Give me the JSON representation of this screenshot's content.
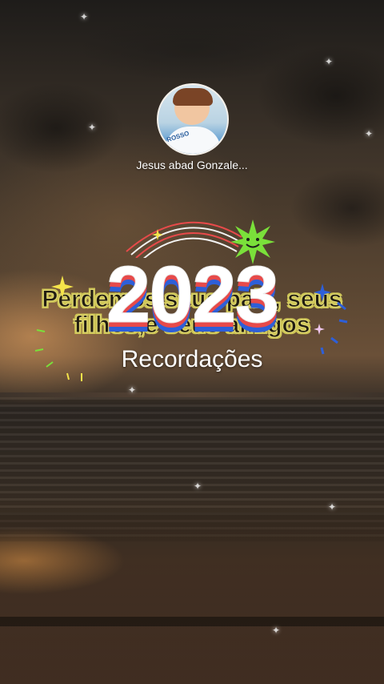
{
  "profile": {
    "username": "Jesus abad Gonzale...",
    "avatar_shirt_text": "ROSSO"
  },
  "overlay": {
    "caption_text": "Perdemos seus pais, seus filhos,e seus amigos",
    "year": "2023",
    "subtitle": "Recordações"
  },
  "colors": {
    "year_fill": "#ffffff",
    "year_stripe_red": "#e74a4a",
    "year_stripe_blue": "#2e5fd8",
    "caption_outline": "#d4cd58",
    "sticker_green": "#7ae03a",
    "sparkle_yellow": "#f5e44a"
  },
  "icons": {
    "smiley_star": "smiley-star-icon",
    "sparkles": "sparkle-icon",
    "rainbow": "rainbow-arc-icon"
  }
}
